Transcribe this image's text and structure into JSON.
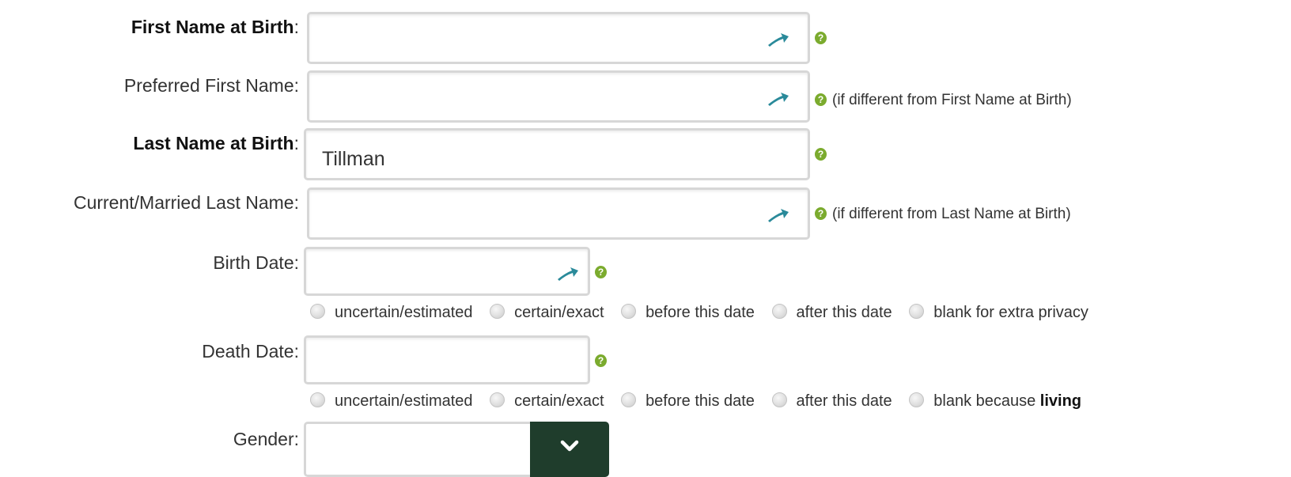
{
  "form": {
    "first_name_birth": {
      "label": "First Name at Birth",
      "colon": ":",
      "value": ""
    },
    "preferred_first": {
      "label": "Preferred First Name:",
      "value": "",
      "note": "(if different from First Name at Birth)"
    },
    "last_name_birth": {
      "label": "Last Name at Birth",
      "colon": ":",
      "value": "Tillman"
    },
    "current_last": {
      "label": "Current/Married Last Name:",
      "value": "",
      "note": "(if different from Last Name at Birth)"
    },
    "birth_date": {
      "label": "Birth Date:",
      "value": "",
      "options": [
        "uncertain/estimated",
        "certain/exact",
        "before this date",
        "after this date",
        "blank for extra privacy"
      ]
    },
    "death_date": {
      "label": "Death Date:",
      "value": "",
      "options": [
        "uncertain/estimated",
        "certain/exact",
        "before this date",
        "after this date"
      ],
      "last_option_prefix": "blank because",
      "last_option_bold": "living"
    },
    "gender": {
      "label": "Gender:",
      "value": ""
    }
  },
  "icons": {
    "lookup": "wt-lookup-icon",
    "help": "help-icon",
    "dropdown": "chevron-down-icon"
  },
  "colors": {
    "help_green": "#7bab2e",
    "lookup_teal": "#2a8a9a",
    "select_button": "#1f3d2c"
  }
}
